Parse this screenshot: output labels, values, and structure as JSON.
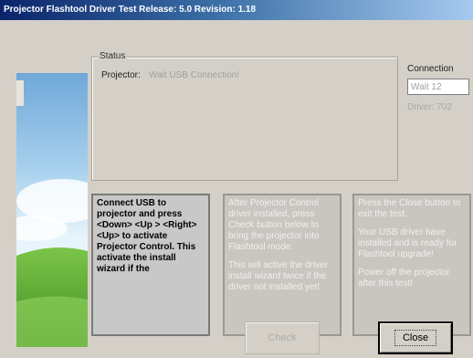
{
  "window": {
    "title": "Projector Flashtool Driver Test   Release: 5.0  Revision: 1.18"
  },
  "status": {
    "legend": "Status",
    "projector_label": "Projector:",
    "projector_value": "Wait USB Connection!"
  },
  "connection": {
    "label": "Connection",
    "value": "Wait 12",
    "driver": "Driver: 702"
  },
  "panels": {
    "instructions": {
      "text": "Connect USB to projector and press <Down> <Up > <Right> <Up> to activate Projector Control. This activate the install wizard if the"
    },
    "step2": {
      "para1": "After Projector Control driver installed, press Check button below to bring the projector into Flashtool mode.",
      "para2": "This will active the driver install wizard twice if the driver not installed yet!"
    },
    "step3": {
      "para1": "Press the Close button to exit the test.",
      "para2": "Your USB driver have installed and is ready for Flashtool upgrade!",
      "para3": "Power off the projector after this test!"
    }
  },
  "buttons": {
    "check": "Check",
    "close": "Close"
  },
  "colors": {
    "title_gradient_start": "#0a246a",
    "title_gradient_end": "#a6caf0",
    "window_bg": "#d4d0c8",
    "disabled_text": "#a0a0a0"
  },
  "icons": {
    "banner": "landscape-banner-image"
  }
}
